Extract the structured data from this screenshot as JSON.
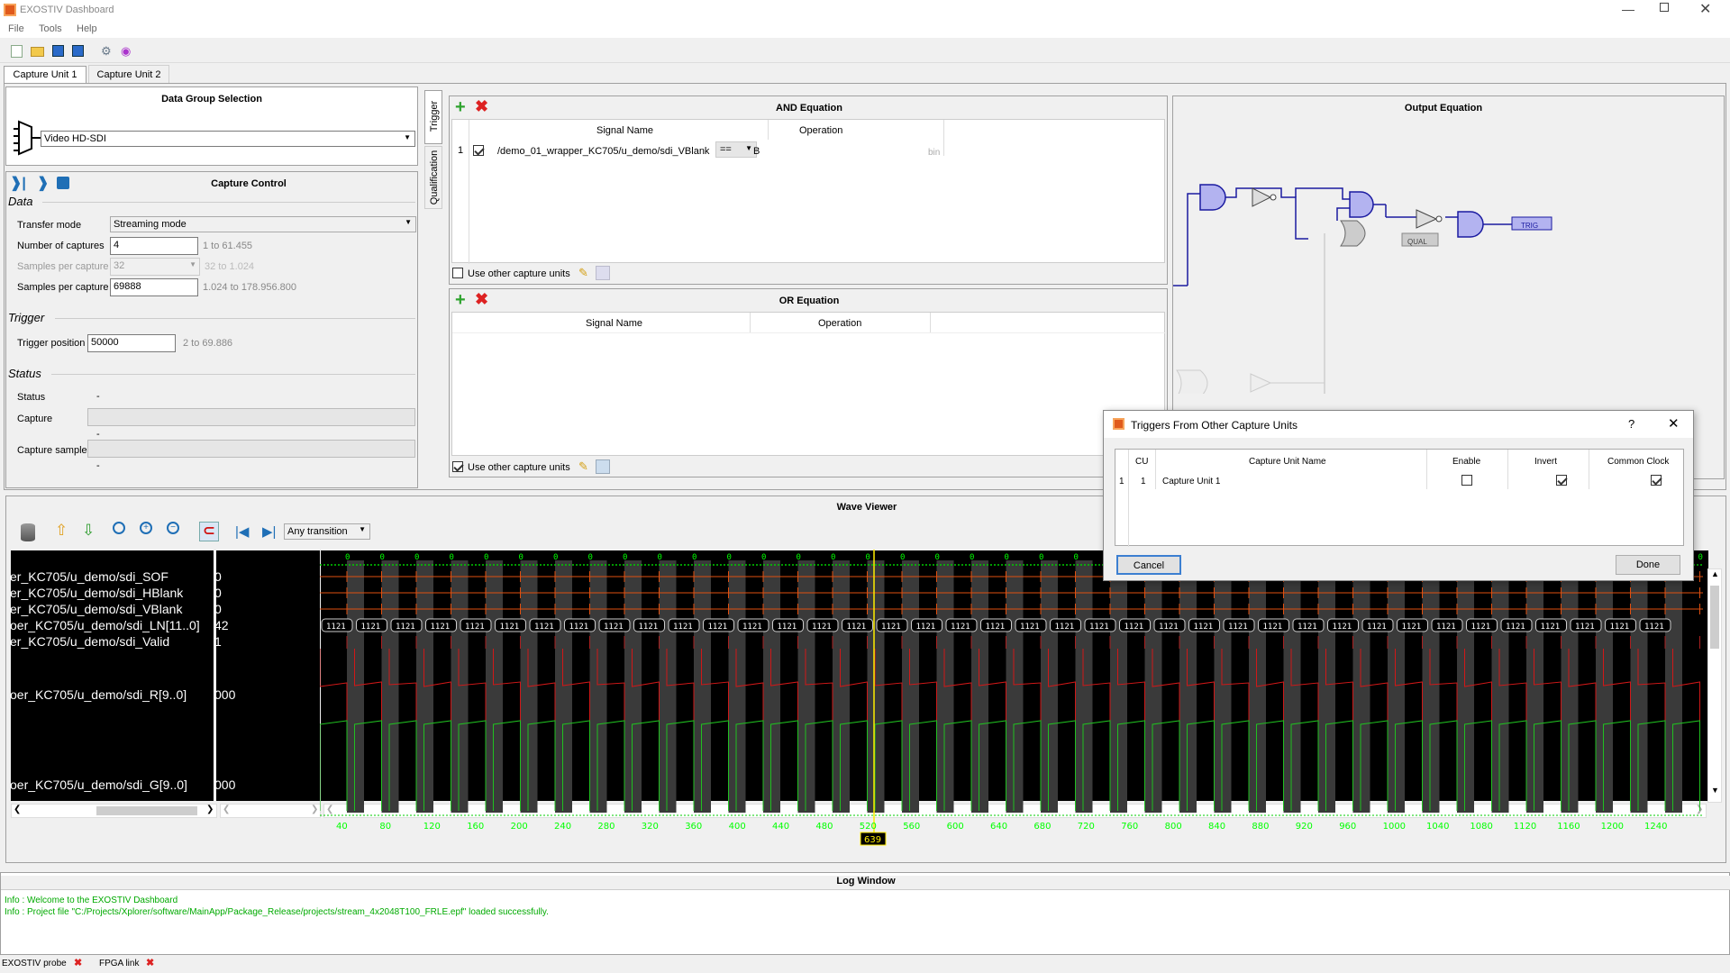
{
  "window": {
    "title": "EXOSTIV Dashboard"
  },
  "menu": [
    "File",
    "Tools",
    "Help"
  ],
  "tabs": [
    "Capture Unit 1",
    "Capture Unit 2"
  ],
  "data_group": {
    "title": "Data Group Selection",
    "selected": "Video HD-SDI"
  },
  "capture_control": {
    "title": "Capture Control",
    "data_section": "Data",
    "transfer_mode_label": "Transfer mode",
    "transfer_mode": "Streaming mode",
    "num_captures_label": "Number of captures",
    "num_captures": "4",
    "num_captures_range": "1  to  61.455",
    "spc_label": "Samples per capture",
    "spc_value": "32",
    "spc_range": "32  to  1.024",
    "spc2_label": "Samples per capture",
    "spc2_value": "69888",
    "spc2_range": "1.024  to  178.956.800",
    "trigger_section": "Trigger",
    "trigger_pos_label": "Trigger position",
    "trigger_pos": "50000",
    "trigger_range": "2  to  69.886",
    "status_section": "Status",
    "status_label": "Status",
    "status_value": "-",
    "capture_label": "Capture",
    "capture_value": "-",
    "capture_sample_label": "Capture sample",
    "capture_sample_value": "-"
  },
  "side_tabs": [
    "Trigger",
    "Qualification"
  ],
  "and_eq": {
    "title": "AND Equation",
    "col1": "Signal Name",
    "col2": "Operation",
    "row_num": "1",
    "signal": "/demo_01_wrapper_KC705/u_demo/sdi_VBlank",
    "op": "==",
    "value": "B",
    "suffix": "bin",
    "use_other": "Use other capture units"
  },
  "or_eq": {
    "title": "OR Equation",
    "col1": "Signal Name",
    "col2": "Operation",
    "use_other": "Use other capture units"
  },
  "output_eq": {
    "title": "Output Equation",
    "qual": "QUAL",
    "trig": "TRIG"
  },
  "wave": {
    "title": "Wave Viewer",
    "transition": "Any transition",
    "signals": [
      {
        "name": "er_KC705/u_demo/sdi_SOF",
        "val": "0"
      },
      {
        "name": "er_KC705/u_demo/sdi_HBlank",
        "val": "0"
      },
      {
        "name": "er_KC705/u_demo/sdi_VBlank",
        "val": "0"
      },
      {
        "name": "oer_KC705/u_demo/sdi_LN[11..0]",
        "val": "42"
      },
      {
        "name": "er_KC705/u_demo/sdi_Valid",
        "val": "1"
      },
      {
        "name": "oer_KC705/u_demo/sdi_R[9..0]",
        "val": "000"
      },
      {
        "name": "oer_KC705/u_demo/sdi_G[9..0]",
        "val": "000"
      }
    ],
    "bus_value": "1121",
    "cursor": "639",
    "ticks": [
      "40",
      "80",
      "120",
      "160",
      "200",
      "240",
      "280",
      "320",
      "360",
      "400",
      "440",
      "480",
      "520",
      "560",
      "600",
      "640",
      "680",
      "720",
      "760",
      "800",
      "840",
      "880",
      "920",
      "960",
      "1000",
      "1040",
      "1080",
      "1120",
      "1160",
      "1200",
      "1240"
    ]
  },
  "dialog": {
    "title": "Triggers From Other Capture Units",
    "help": "?",
    "cols": [
      "CU",
      "Capture Unit Name",
      "Enable",
      "Invert",
      "Common Clock"
    ],
    "row": {
      "idx": "1",
      "cu": "1",
      "name": "Capture Unit 1"
    },
    "cancel": "Cancel",
    "done": "Done"
  },
  "log": {
    "title": "Log Window",
    "lines": [
      "Info : Welcome to the EXOSTIV Dashboard",
      "Info : Project file \"C:/Projects/Xplorer/software/MainApp/Package_Release/projects/stream_4x2048T100_FRLE.epf\" loaded successfully."
    ]
  },
  "statusbar": {
    "probe": "EXOSTIV probe",
    "link": "FPGA link"
  }
}
